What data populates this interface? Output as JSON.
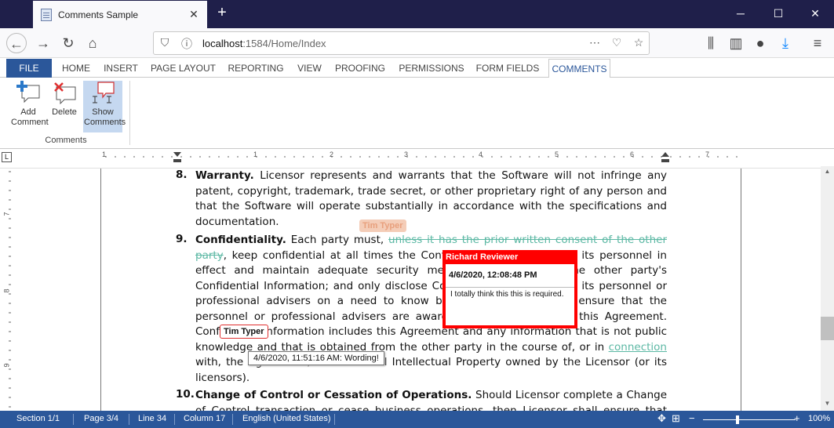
{
  "browser": {
    "tab_title": "Comments Sample",
    "url_host": "localhost",
    "url_rest": ":1584/Home/Index",
    "new_tab": "+",
    "minimize": "─",
    "maximize": "☐",
    "close": "✕",
    "tab_close": "✕"
  },
  "ribbon": {
    "tabs": [
      "FILE",
      "HOME",
      "INSERT",
      "PAGE LAYOUT",
      "REPORTING",
      "VIEW",
      "PROOFING",
      "PERMISSIONS",
      "FORM FIELDS",
      "COMMENTS"
    ],
    "active_tab": "COMMENTS",
    "buttons": {
      "add": "Add Comment",
      "delete": "Delete",
      "show": "Show Comments"
    },
    "group_label": "Comments"
  },
  "ruler": {
    "marks": [
      "1",
      "1",
      "2",
      "3",
      "4",
      "5",
      "6",
      "7"
    ]
  },
  "vruler": {
    "marks": [
      "7",
      "8",
      "9"
    ]
  },
  "document": {
    "p8_num": "8.",
    "p8_title": "Warranty.",
    "p8_text": "Licensor represents and warrants that the Software will not infringe any patent, copyright, trademark, trade secret, or other proprietary right of any person and that the Software will operate substantially in accordance with the specifications and documentation.",
    "p9_num": "9.",
    "p9_title": "Confidentiality.",
    "p9_a": "Each party must,",
    "p9_deleted": "unless it has the prior written consent of the other party",
    "p9_b": ", keep confidential at all times the Confidential Information",
    "p9_c": "and its personnel in effect and maintain adequate security measures to safeguard the other party's Confidential Information; and only disclose Confidential Information to its personnel or professional advisers on a need to know basis and, in that case, ensure that the personnel or professional advisers are aware of and complies with this Agreement. Confidential Information includes this Agreement and any information that is not public knowledge and that is obtained from the other party in the course of, or in",
    "p9_inserted": "connection",
    "p9_d": "with, the Agreement, as well as all Intellectual Property owned by the Licensor (or its licensors).",
    "p10_num": "10.",
    "p10_title": "Change of Control or Cessation of Operations.",
    "p10_text": "Should Licensor complete a Change of Control transaction or cease business operations, then Licensor shall ensure that Licensee remains able to"
  },
  "comments": {
    "author_ghost": "Tim Typer",
    "author_tag": "Tim Typer",
    "popup_author": "Richard Reviewer",
    "popup_date": "4/6/2020, 12:08:48 PM",
    "popup_text": "I totally think this this is required.",
    "tooltip": "4/6/2020, 11:51:16 AM: Wording!"
  },
  "status": {
    "section": "Section 1/1",
    "page": "Page 3/4",
    "line": "Line 34",
    "column": "Column 17",
    "language": "English (United States)",
    "zoom": "100%"
  },
  "colors": {
    "accent": "#2b579a",
    "comment_red": "#ff0000",
    "tracked_change": "#5cb8a4"
  }
}
